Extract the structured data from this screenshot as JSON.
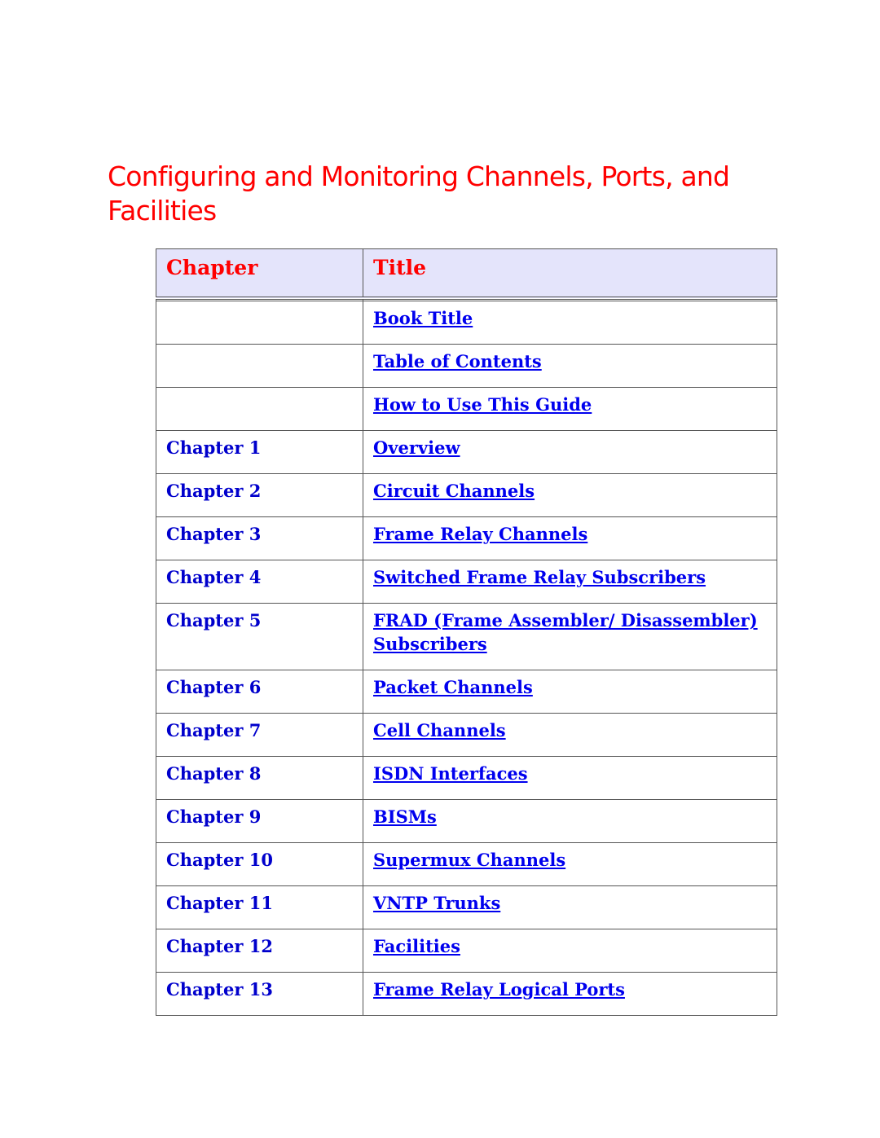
{
  "heading": "Configuring and Monitoring Channels, Ports, and Facilities",
  "table": {
    "headers": {
      "chapter": "Chapter",
      "title": "Title"
    },
    "rows": [
      {
        "chapter": "",
        "title": "Book Title"
      },
      {
        "chapter": "",
        "title": "Table of Contents"
      },
      {
        "chapter": "",
        "title": "How to Use This Guide"
      },
      {
        "chapter": "Chapter 1",
        "title": "Overview"
      },
      {
        "chapter": "Chapter 2",
        "title": "Circuit Channels"
      },
      {
        "chapter": "Chapter 3",
        "title": "Frame Relay Channels"
      },
      {
        "chapter": "Chapter 4",
        "title": "Switched Frame Relay Subscribers"
      },
      {
        "chapter": "Chapter 5",
        "title": "FRAD (Frame Assembler/ Disassembler) Subscribers"
      },
      {
        "chapter": "Chapter 6",
        "title": "Packet Channels"
      },
      {
        "chapter": "Chapter 7",
        "title": "Cell Channels"
      },
      {
        "chapter": "Chapter 8",
        "title": "ISDN Interfaces"
      },
      {
        "chapter": "Chapter 9",
        "title": "BISMs"
      },
      {
        "chapter": "Chapter 10",
        "title": "Supermux Channels"
      },
      {
        "chapter": "Chapter 11",
        "title": "VNTP Trunks"
      },
      {
        "chapter": "Chapter 12",
        "title": "Facilities"
      },
      {
        "chapter": "Chapter 13",
        "title": "Frame Relay Logical Ports"
      }
    ]
  },
  "colors": {
    "heading": "#ff0000",
    "header_bg": "#e4e4fb",
    "link": "#0000ee"
  }
}
